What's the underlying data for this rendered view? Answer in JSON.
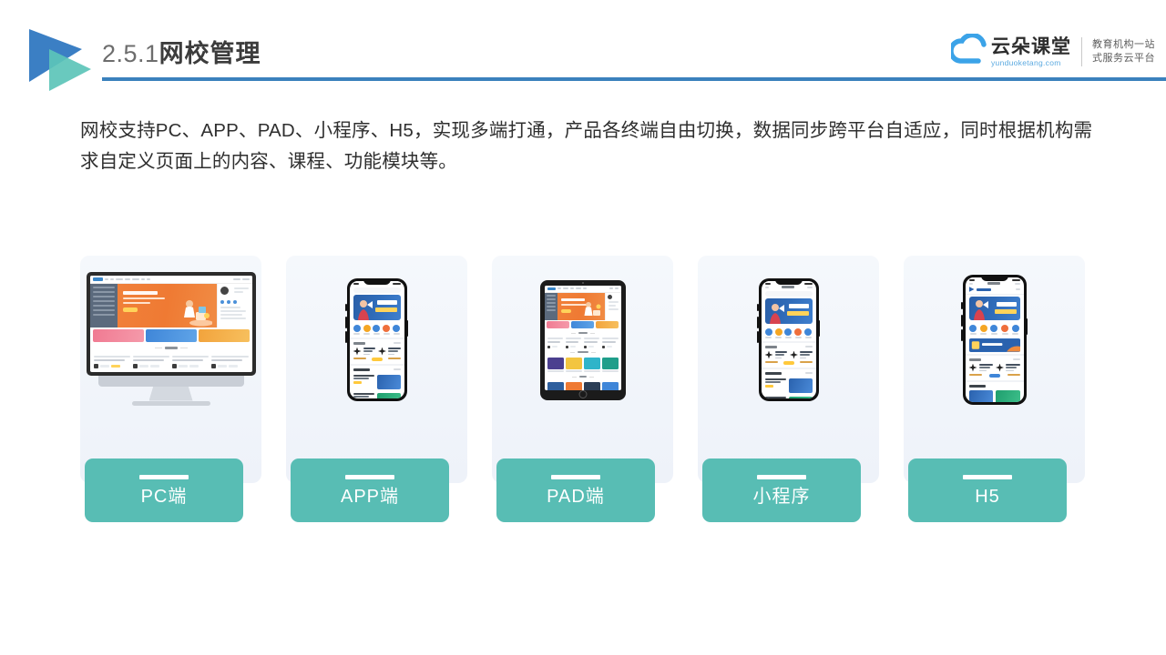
{
  "header": {
    "section_number": "2.5.1",
    "title_cn": "网校管理",
    "rule_color": "#3b81bd",
    "logo_triangle_blue": "#3b7fc4",
    "logo_triangle_teal": "#5cc4b8"
  },
  "brand": {
    "name": "云朵课堂",
    "url": "yunduoketang.com",
    "tagline_line1": "教育机构一站",
    "tagline_line2": "式服务云平台",
    "cloud_color": "#3ba3e8",
    "icon": "cloud-icon"
  },
  "body": {
    "paragraph": "网校支持PC、APP、PAD、小程序、H5，实现多端打通，产品各终端自由切换，数据同步跨平台自适应，同时根据机构需求自定义页面上的内容、课程、功能模块等。"
  },
  "cards": {
    "accent_color": "#58bdb4",
    "card_bg": "#f2f5fa",
    "items": [
      {
        "label": "PC端",
        "device": "desktop",
        "name": "pc"
      },
      {
        "label": "APP端",
        "device": "phone",
        "name": "app"
      },
      {
        "label": "PAD端",
        "device": "tablet",
        "name": "pad"
      },
      {
        "label": "小程序",
        "device": "phone",
        "name": "miniprogram"
      },
      {
        "label": "H5",
        "device": "phone",
        "name": "h5"
      }
    ]
  }
}
